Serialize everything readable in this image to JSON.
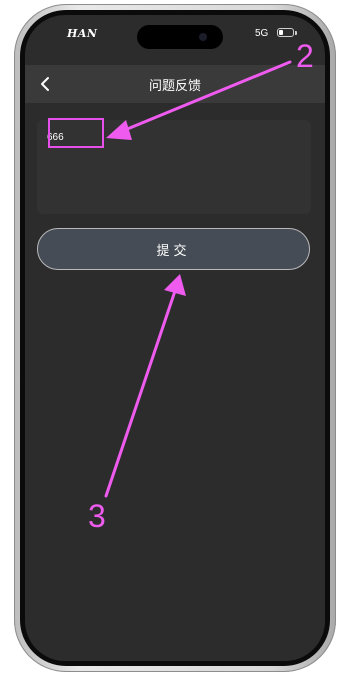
{
  "status_bar": {
    "carrier": "HAN",
    "network": "5G",
    "battery_level": 0.3
  },
  "nav": {
    "title": "问题反馈",
    "back_icon": "chevron-left-icon"
  },
  "feedback": {
    "value": "666"
  },
  "submit": {
    "label": "提交"
  },
  "annotations": {
    "callout_2": "2",
    "callout_3": "3",
    "color": "#ee5bee"
  }
}
